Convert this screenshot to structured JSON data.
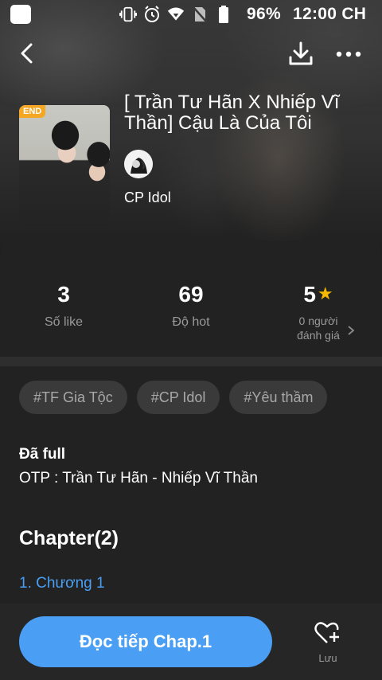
{
  "status_bar": {
    "battery_percent": "96%",
    "time": "12:00 CH",
    "icons": [
      "vibrate-icon",
      "alarm-icon",
      "wifi-icon",
      "no-sim-icon",
      "battery-icon"
    ]
  },
  "header": {
    "back_icon": "back-arrow-icon",
    "download_icon": "download-icon",
    "more_icon": "more-dots-icon"
  },
  "story": {
    "badge": "END",
    "title": "[ Trần Tư Hãn X Nhiếp Vĩ Thần] Cậu Là Của Tôi",
    "author": "CP Idol"
  },
  "stats": {
    "likes": {
      "value": "3",
      "label": "Số like"
    },
    "hot": {
      "value": "69",
      "label": "Độ hot"
    },
    "rating": {
      "value": "5",
      "label_line1": "0 người",
      "label_line2": "đánh giá"
    }
  },
  "tags": [
    "#TF Gia Tộc",
    "#CP Idol",
    "#Yêu thầm"
  ],
  "description": {
    "line1": "Đã full",
    "line2": "OTP : Trần Tư Hãn - Nhiếp Vĩ Thần"
  },
  "chapters": {
    "title": "Chapter(2)",
    "items": [
      "1. Chương 1"
    ]
  },
  "bottom": {
    "read_button": "Đọc tiếp Chap.1",
    "save_label": "Lưu"
  },
  "colors": {
    "accent": "#4a9ff5",
    "star": "#f5b800",
    "badge": "#f5a623",
    "background": "#222222"
  }
}
